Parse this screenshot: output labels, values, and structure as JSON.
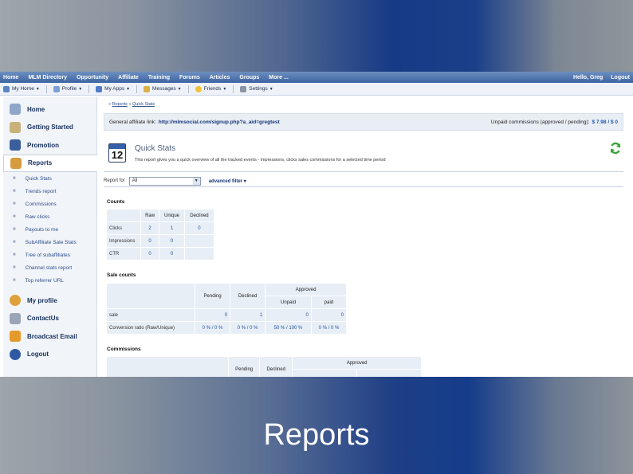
{
  "slide": {
    "caption": "Reports"
  },
  "topnav": {
    "items": [
      "Home",
      "MLM Directory",
      "Opportunity",
      "Affiliate",
      "Training",
      "Forums",
      "Articles",
      "Groups",
      "More ..."
    ],
    "greeting": "Hello, Greg",
    "logout": "Logout"
  },
  "toolbar": {
    "items": [
      "My Home",
      "Profile",
      "My Apps",
      "Messages",
      "Friends",
      "Settings"
    ]
  },
  "sidebar": {
    "main_top": [
      "Home",
      "Getting Started",
      "Promotion",
      "Reports"
    ],
    "sub": [
      "Quick Stats",
      "Trends report",
      "Commissions",
      "Raw clicks",
      "Payouts to me",
      "SubAffiliate Sale Stats",
      "Tree of subaffiliates",
      "Channel stats report",
      "Top referrer URL"
    ],
    "main_bottom": [
      "My profile",
      "ContactUs",
      "Broadcast Email",
      "Logout"
    ]
  },
  "breadcrumb": {
    "first": "Reports",
    "second": "Quick Stats"
  },
  "infobar": {
    "label": "General affiliate link:",
    "link": "http://mlmsocial.com/signup.php?a_aid=gregtest",
    "commissions_label": "Unpaid commissions (approved / pending):",
    "commissions_value": "$ 7.98 / $ 0"
  },
  "quick_stats": {
    "calendar_day": "12",
    "title": "Quick Stats",
    "description": "This report gives you a quick overview of all the tracked events - impressions, clicks sales commissions for a selected time period"
  },
  "filter": {
    "label": "Report for",
    "value": "All",
    "advanced": "advanced filter"
  },
  "counts": {
    "title": "Counts",
    "headers": [
      "Raw",
      "Unique",
      "Declined"
    ],
    "rows": [
      {
        "label": "Clicks",
        "values": [
          "2",
          "1",
          "0"
        ]
      },
      {
        "label": "Impressions",
        "values": [
          "0",
          "0",
          ""
        ]
      },
      {
        "label": "CTR",
        "values": [
          "0",
          "0",
          ""
        ]
      }
    ]
  },
  "sale_counts": {
    "title": "Sale counts",
    "headers": {
      "pending": "Pending",
      "declined": "Declined",
      "approved": "Approved",
      "unpaid": "Unpaid",
      "paid": "paid"
    },
    "rows": [
      {
        "label": "sale",
        "values": [
          "0",
          "1",
          "0",
          "0"
        ]
      },
      {
        "label": "Conversion ratio (Raw/Unique)",
        "values": [
          "0 % / 0 %",
          "0 % / 0 %",
          "50 % / 100 %",
          "0 % / 0 %"
        ]
      }
    ]
  },
  "commissions": {
    "title": "Commissions",
    "headers": {
      "pending": "Pending",
      "declined": "Declined",
      "approved": "Approved"
    }
  }
}
